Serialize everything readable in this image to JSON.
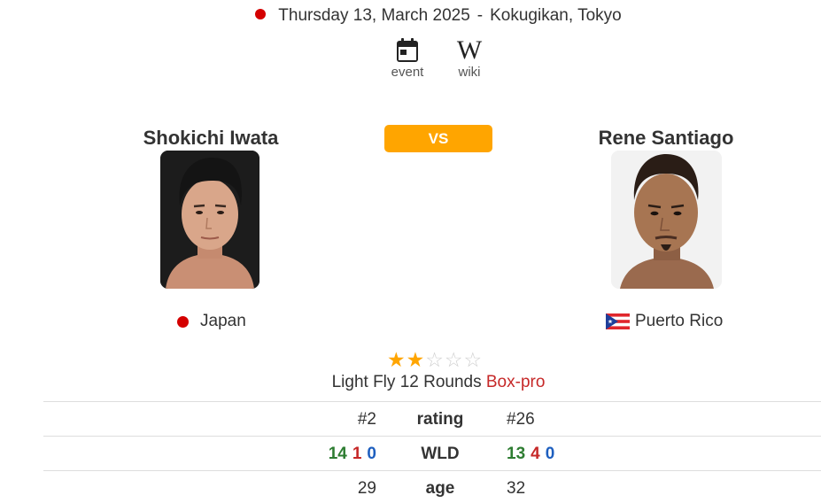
{
  "event": {
    "date": "Thursday 13, March 2025",
    "separator": "-",
    "venue": "Kokugikan, Tokyo"
  },
  "links": [
    {
      "label": "event",
      "icon": "calendar-icon"
    },
    {
      "label": "wiki",
      "icon": "wikipedia-icon"
    }
  ],
  "vs_label": "VS",
  "fighters": {
    "left": {
      "name": "Shokichi Iwata",
      "country": "Japan",
      "flag": "japan-flag-icon"
    },
    "right": {
      "name": "Rene Santiago",
      "country": "Puerto Rico",
      "flag": "puerto-rico-flag-icon"
    }
  },
  "rating_stars": {
    "filled": 2,
    "total": 5
  },
  "bout": {
    "division": "Light Fly",
    "rounds": "12 Rounds",
    "type": "Box-pro"
  },
  "stats": {
    "rating": {
      "label": "rating",
      "left": "#2",
      "right": "#26"
    },
    "wld": {
      "label": "WLD",
      "left": {
        "w": "14",
        "l": "1",
        "d": "0"
      },
      "right": {
        "w": "13",
        "l": "4",
        "d": "0"
      }
    },
    "age": {
      "label": "age",
      "left": "29",
      "right": "32"
    }
  },
  "colors": {
    "accent": "#ffa500",
    "win": "#2e7d32",
    "loss": "#c62828",
    "draw": "#1e5fbf",
    "dot": "#d40000"
  }
}
